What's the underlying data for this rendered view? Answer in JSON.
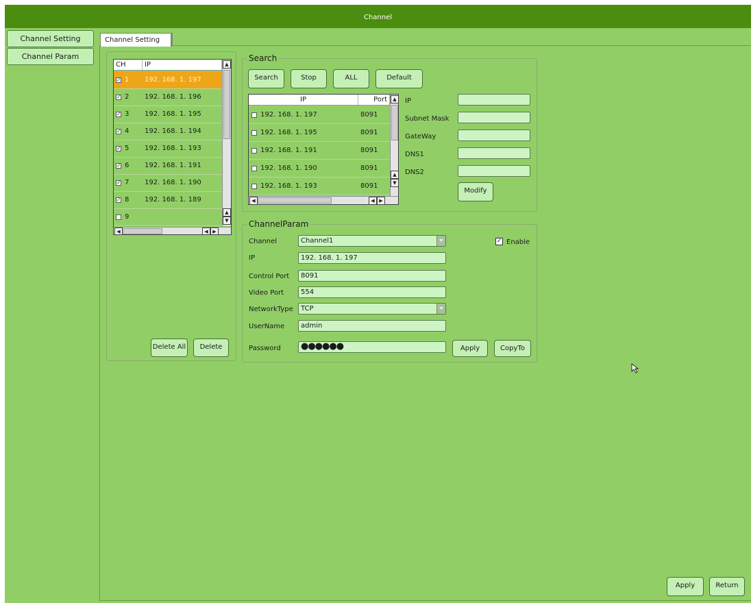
{
  "window": {
    "title": "Channel"
  },
  "sidebar": {
    "items": [
      {
        "label": "Channel Setting"
      },
      {
        "label": "Channel Param"
      }
    ]
  },
  "tab": {
    "label": "Channel Setting"
  },
  "channel_list": {
    "headers": [
      "CH",
      "IP"
    ],
    "rows": [
      {
        "ch": "1",
        "ip": "192. 168. 1. 197",
        "checked": true
      },
      {
        "ch": "2",
        "ip": "192. 168. 1. 196",
        "checked": true
      },
      {
        "ch": "3",
        "ip": "192. 168. 1. 195",
        "checked": true
      },
      {
        "ch": "4",
        "ip": "192. 168. 1. 194",
        "checked": true
      },
      {
        "ch": "5",
        "ip": "192. 168. 1. 193",
        "checked": true
      },
      {
        "ch": "6",
        "ip": "192. 168. 1. 191",
        "checked": true
      },
      {
        "ch": "7",
        "ip": "192. 168. 1. 190",
        "checked": true
      },
      {
        "ch": "8",
        "ip": "192. 168. 1. 189",
        "checked": true
      },
      {
        "ch": "9",
        "ip": "",
        "checked": false
      }
    ],
    "delete_all": "Delete All",
    "delete": "Delete"
  },
  "search": {
    "title": "Search",
    "buttons": {
      "search": "Search",
      "stop": "Stop",
      "all": "ALL",
      "default": "Default"
    },
    "headers": [
      "IP",
      "Port"
    ],
    "rows": [
      {
        "ip": "192. 168. 1. 197",
        "port": "8091"
      },
      {
        "ip": "192. 168. 1. 195",
        "port": "8091"
      },
      {
        "ip": "192. 168. 1. 191",
        "port": "8091"
      },
      {
        "ip": "192. 168. 1. 190",
        "port": "8091"
      },
      {
        "ip": "192. 168. 1. 193",
        "port": "8091"
      }
    ],
    "labels": {
      "ip": "IP",
      "subnet": "Subnet Mask",
      "gateway": "GateWay",
      "dns1": "DNS1",
      "dns2": "DNS2"
    },
    "values": {
      "ip": "",
      "subnet": "",
      "gateway": "",
      "dns1": "",
      "dns2": ""
    },
    "modify": "Modify"
  },
  "channel_param": {
    "title": "ChannelParam",
    "labels": {
      "channel": "Channel",
      "ip": "IP",
      "control_port": "Control Port",
      "video_port": "Video Port",
      "network_type": "NetworkType",
      "username": "UserName",
      "password": "Password"
    },
    "values": {
      "channel": "Channel1",
      "ip": "192. 168. 1. 197",
      "control_port": "8091",
      "video_port": "554",
      "network_type": "TCP",
      "username": "admin",
      "password": "●●●●●●"
    },
    "enable_label": "Enable",
    "enable_checked": true,
    "apply": "Apply",
    "copyto": "CopyTo"
  },
  "footer": {
    "apply": "Apply",
    "return": "Return"
  },
  "colors": {
    "background": "#91cf66",
    "titlebar": "#4a8d0f",
    "selected_row": "#efa518",
    "button": "#c4f0b5"
  }
}
